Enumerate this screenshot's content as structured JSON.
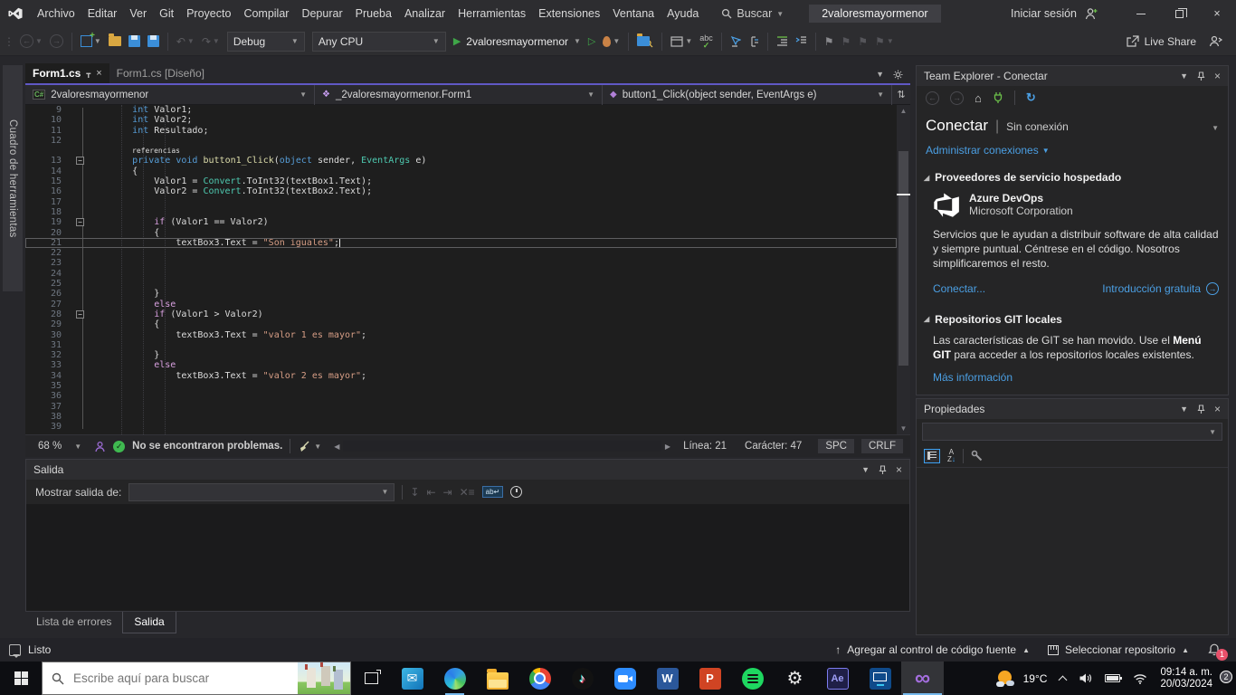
{
  "title_bar": {
    "menus": [
      "Archivo",
      "Editar",
      "Ver",
      "Git",
      "Proyecto",
      "Compilar",
      "Depurar",
      "Prueba",
      "Analizar",
      "Herramientas",
      "Extensiones",
      "Ventana",
      "Ayuda"
    ],
    "search": "Buscar",
    "solution": "2valoresmayormenor",
    "sign_in": "Iniciar sesión"
  },
  "toolbar": {
    "configuration": "Debug",
    "platform": "Any CPU",
    "start_target": "2valoresmayormenor",
    "live_share": "Live Share"
  },
  "toolbox_tab": "Cuadro de herramientas",
  "editor": {
    "tabs": [
      {
        "label": "Form1.cs",
        "active": true
      },
      {
        "label": "Form1.cs [Diseño]",
        "active": false
      }
    ],
    "navbar": {
      "project": "2valoresmayormenor",
      "type": "_2valoresmayormenor.Form1",
      "member": "button1_Click(object sender, EventArgs e)"
    },
    "code": [
      {
        "n": "9",
        "t": [
          [
            "pl",
            "        "
          ],
          [
            "kw",
            "int"
          ],
          [
            "pl",
            " Valor1;"
          ]
        ]
      },
      {
        "n": "10",
        "t": [
          [
            "pl",
            "        "
          ],
          [
            "kw",
            "int"
          ],
          [
            "pl",
            " Valor2;"
          ]
        ]
      },
      {
        "n": "11",
        "t": [
          [
            "pl",
            "        "
          ],
          [
            "kw",
            "int"
          ],
          [
            "pl",
            " Resultado;"
          ]
        ]
      },
      {
        "n": "12",
        "t": []
      },
      {
        "lens": true,
        "t": [
          [
            "pl",
            "referencias"
          ]
        ]
      },
      {
        "n": "13",
        "fold": true,
        "t": [
          [
            "pl",
            "        "
          ],
          [
            "kw",
            "private"
          ],
          [
            "pl",
            " "
          ],
          [
            "kw",
            "void"
          ],
          [
            "pl",
            " "
          ],
          [
            "m",
            "button1_Click"
          ],
          [
            "pl",
            "("
          ],
          [
            "kw",
            "object"
          ],
          [
            "pl",
            " sender, "
          ],
          [
            "ty",
            "EventArgs"
          ],
          [
            "pl",
            " e)"
          ]
        ]
      },
      {
        "n": "14",
        "t": [
          [
            "pl",
            "        {"
          ]
        ]
      },
      {
        "n": "15",
        "t": [
          [
            "pl",
            "            Valor1 = "
          ],
          [
            "ty",
            "Convert"
          ],
          [
            "pl",
            ".ToInt32(textBox1.Text);"
          ]
        ]
      },
      {
        "n": "16",
        "t": [
          [
            "pl",
            "            Valor2 = "
          ],
          [
            "ty",
            "Convert"
          ],
          [
            "pl",
            ".ToInt32(textBox2.Text);"
          ]
        ]
      },
      {
        "n": "17",
        "t": []
      },
      {
        "n": "18",
        "t": []
      },
      {
        "n": "19",
        "fold": true,
        "t": [
          [
            "pl",
            "            "
          ],
          [
            "ctl",
            "if"
          ],
          [
            "pl",
            " (Valor1 == Valor2)"
          ]
        ]
      },
      {
        "n": "20",
        "t": [
          [
            "pl",
            "            {"
          ]
        ]
      },
      {
        "n": "21",
        "cur": true,
        "t": [
          [
            "pl",
            "                textBox3.Text = "
          ],
          [
            "st",
            "\"Son iguales\""
          ],
          [
            "pl",
            ";"
          ]
        ]
      },
      {
        "n": "22",
        "t": []
      },
      {
        "n": "23",
        "t": []
      },
      {
        "n": "24",
        "t": []
      },
      {
        "n": "25",
        "t": []
      },
      {
        "n": "26",
        "t": [
          [
            "pl",
            "            }"
          ]
        ]
      },
      {
        "n": "27",
        "t": [
          [
            "pl",
            "            "
          ],
          [
            "ctl",
            "else"
          ]
        ]
      },
      {
        "n": "28",
        "fold": true,
        "t": [
          [
            "pl",
            "            "
          ],
          [
            "ctl",
            "if"
          ],
          [
            "pl",
            " (Valor1 > Valor2)"
          ]
        ]
      },
      {
        "n": "29",
        "t": [
          [
            "pl",
            "            {"
          ]
        ]
      },
      {
        "n": "30",
        "t": [
          [
            "pl",
            "                textBox3.Text = "
          ],
          [
            "st",
            "\"valor 1 es mayor\""
          ],
          [
            "pl",
            ";"
          ]
        ]
      },
      {
        "n": "31",
        "t": []
      },
      {
        "n": "32",
        "t": [
          [
            "pl",
            "            }"
          ]
        ]
      },
      {
        "n": "33",
        "t": [
          [
            "pl",
            "            "
          ],
          [
            "ctl",
            "else"
          ]
        ]
      },
      {
        "n": "34",
        "t": [
          [
            "pl",
            "                textBox3.Text = "
          ],
          [
            "st",
            "\"valor 2 es mayor\""
          ],
          [
            "pl",
            ";"
          ]
        ]
      },
      {
        "n": "35",
        "t": []
      },
      {
        "n": "36",
        "t": []
      },
      {
        "n": "37",
        "t": []
      },
      {
        "n": "38",
        "t": []
      },
      {
        "n": "39",
        "t": []
      }
    ],
    "status": {
      "zoom": "68 %",
      "problems": "No se encontraron problemas.",
      "line": "Línea: 21",
      "column": "Carácter: 47",
      "insert_mode": "SPC",
      "line_ending": "CRLF"
    }
  },
  "team_explorer": {
    "title": "Team Explorer - Conectar",
    "heading": "Conectar",
    "connection_status": "Sin conexión",
    "manage_connections": "Administrar conexiones",
    "hosted_providers": "Proveedores de servicio hospedado",
    "azure": {
      "name": "Azure DevOps",
      "vendor": "Microsoft Corporation",
      "description": "Servicios que le ayudan a distribuir software de alta calidad y siempre puntual. Céntrese en el código. Nosotros simplificaremos el resto.",
      "connect": "Conectar...",
      "get_started": "Introducción gratuita"
    },
    "local_git": "Repositorios GIT locales",
    "git_text_1": "Las características de GIT se han movido. Use el ",
    "git_text_bold": "Menú GIT",
    "git_text_2": " para acceder a los repositorios locales existentes.",
    "more_info": "Más información"
  },
  "properties_panel": {
    "title": "Propiedades"
  },
  "output_panel": {
    "title": "Salida",
    "show_output_from": "Mostrar salida de:"
  },
  "bottom_tabs": [
    {
      "label": "Lista de errores",
      "active": false
    },
    {
      "label": "Salida",
      "active": true
    }
  ],
  "status_bar": {
    "ready": "Listo",
    "add_to_source_control": "Agregar al control de código fuente",
    "select_repository": "Seleccionar repositorio",
    "notifications_badge": "1"
  },
  "taskbar": {
    "search_placeholder": "Escribe aquí para buscar",
    "apps": [
      "mail",
      "edge",
      "explorer",
      "chrome",
      "tiktok",
      "zoom",
      "word",
      "powerpoint",
      "spotify",
      "settings",
      "after-effects",
      "company-portal",
      "visual-studio"
    ],
    "tray": {
      "temperature": "19°C",
      "time": "09:14 a. m.",
      "date": "20/03/2024",
      "notification_badge": "2"
    }
  }
}
